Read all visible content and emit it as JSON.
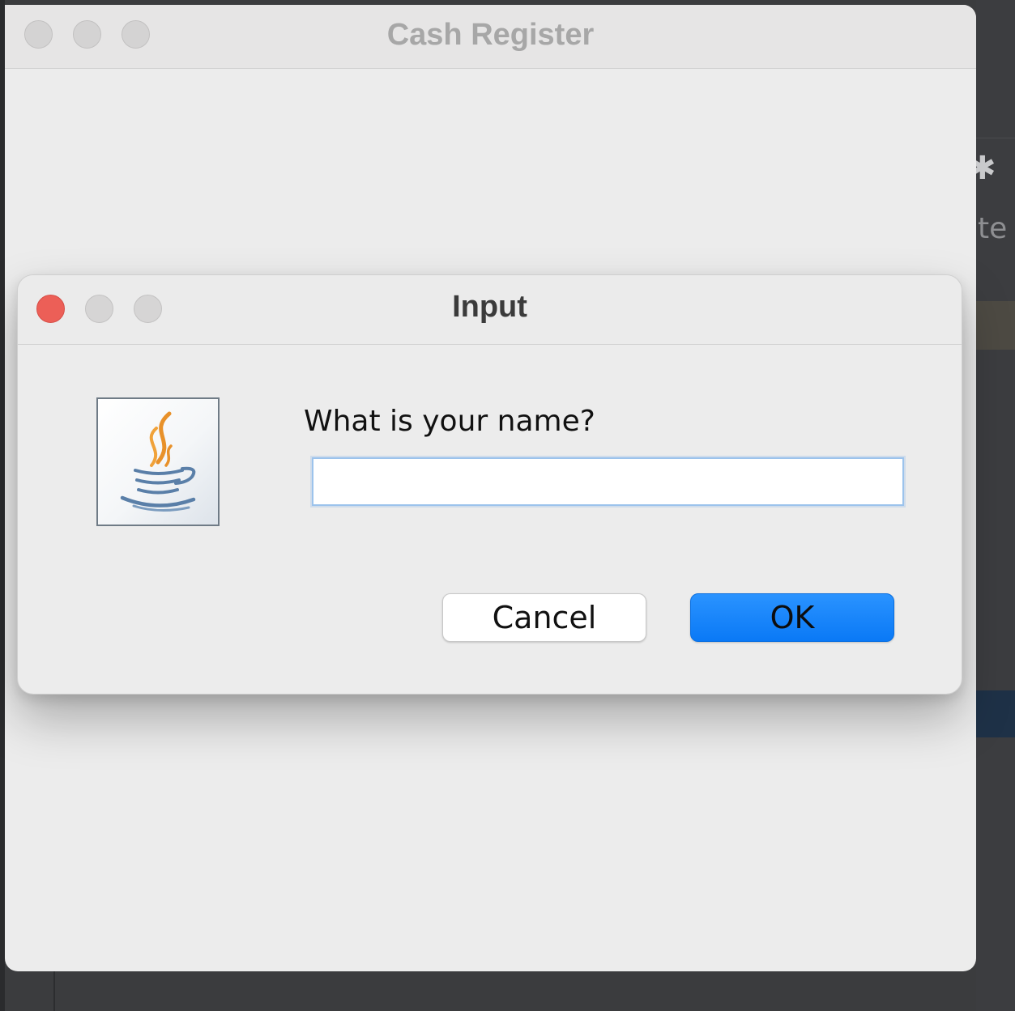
{
  "background": {
    "partial_text": "ite",
    "gear_glyph": "✱"
  },
  "main_window": {
    "title": "Cash Register"
  },
  "dialog": {
    "title": "Input",
    "prompt": "What is your name?",
    "input_value": "",
    "input_placeholder": "",
    "cancel_label": "Cancel",
    "ok_label": "OK"
  },
  "colors": {
    "close_button": "#ec5f57",
    "ok_button": "#0a7bf7",
    "input_focus_border": "#9cc3ec",
    "java_cup_blue": "#5a7fa8",
    "java_steam_orange": "#e8912a"
  },
  "icons": {
    "dialog_icon": "java-coffee-cup-icon",
    "settings": "gear-icon"
  }
}
